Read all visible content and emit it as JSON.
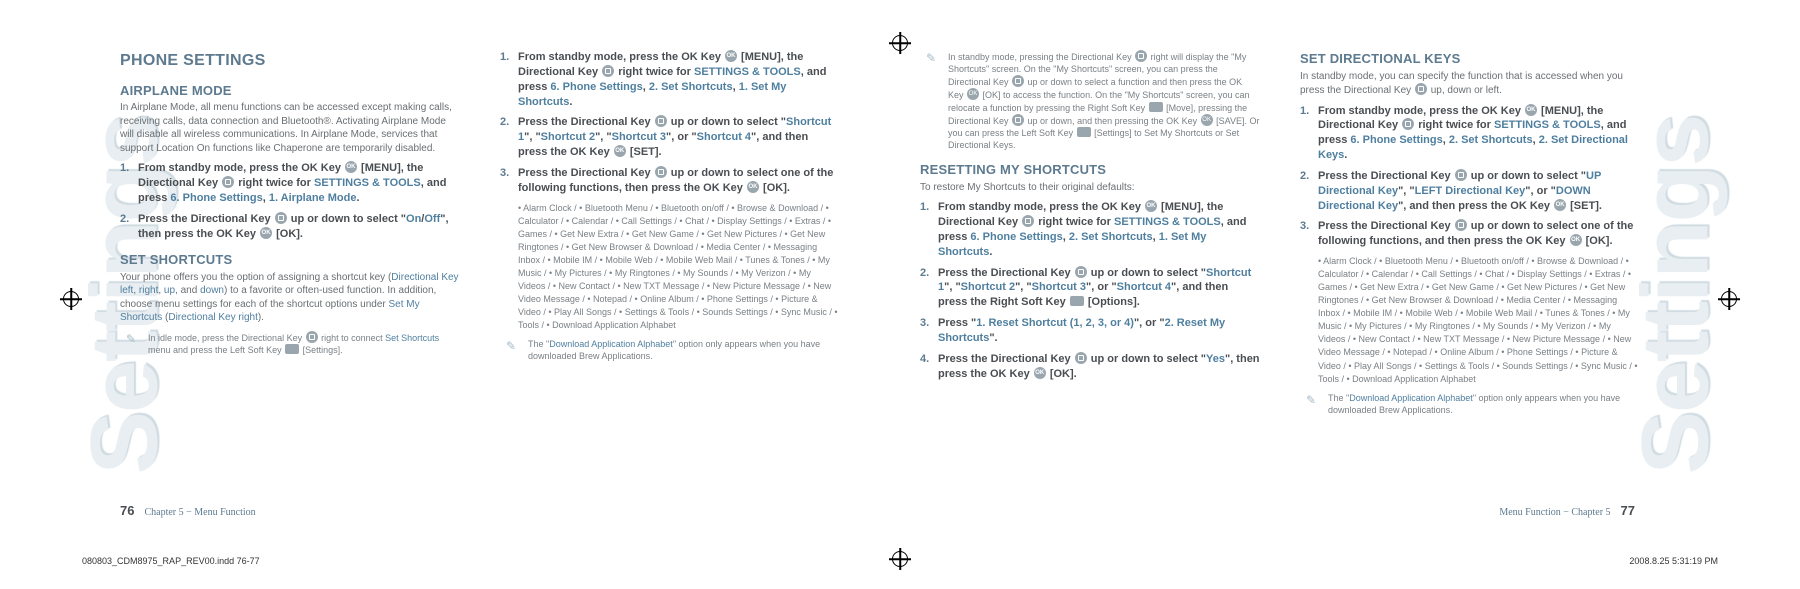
{
  "watermark": "Settings",
  "left": {
    "col1": {
      "h1": "PHONE SETTINGS",
      "airplane_h": "AIRPLANE MODE",
      "airplane_intro": "In Airplane Mode, all menu functions can be accessed except making calls, receiving calls, data connection and Bluetooth®. Activating Airplane Mode will disable all wireless communications. In Airplane Mode, services that support Location On functions like Chaperone are temporarily disabled.",
      "ap_s1a": "From standby mode, press the OK Key ",
      "ap_s1b": " [MENU], the Directional Key ",
      "ap_s1c": " right twice for ",
      "ap_s1d": "SETTINGS & TOOLS",
      "ap_s1e": ", and press ",
      "ap_s1f": "6. Phone Settings",
      "ap_s1g": ", ",
      "ap_s1h": "1. Airplane Mode",
      "ap_s1i": ".",
      "ap_s2a": "Press the Directional Key ",
      "ap_s2b": " up or down to select \"",
      "ap_s2c": "On",
      "ap_s2d": "/",
      "ap_s2e": "Off",
      "ap_s2f": "\", then press the OK Key ",
      "ap_s2g": " [OK].",
      "ss_h": "SET SHORTCUTS",
      "ss_intro_a": "Your phone offers you the option of assigning a shortcut key (",
      "ss_intro_b": "Directional Key left",
      "ss_intro_c": ", ",
      "ss_intro_d": "right",
      "ss_intro_e": ", ",
      "ss_intro_f": "up",
      "ss_intro_g": ", and ",
      "ss_intro_h": "down",
      "ss_intro_i": ") to a favorite or often-used function. In addition, choose menu settings for each of the shortcut options under ",
      "ss_intro_j": "Set My Shortcuts",
      "ss_intro_k": " (",
      "ss_intro_l": "Directional Key right",
      "ss_intro_m": ").",
      "ss_note_a": "In idle mode, press the Directional Key ",
      "ss_note_b": " right to connect ",
      "ss_note_c": "Set Shortcuts",
      "ss_note_d": " menu and press the Left Soft Key ",
      "ss_note_e": " [Settings]."
    },
    "col2": {
      "s1a": "From standby mode, press the OK Key ",
      "s1b": " [MENU], the Directional Key ",
      "s1c": " right twice for ",
      "s1d": "SETTINGS & TOOLS",
      "s1e": ", and press ",
      "s1f": "6. Phone Settings",
      "s1g": ", ",
      "s1h": "2. Set Shortcuts",
      "s1i": ", ",
      "s1j": "1. Set My Shortcuts",
      "s1k": ".",
      "s2a": "Press the Directional Key ",
      "s2b": " up or down to select \"",
      "s2c": "Shortcut 1",
      "s2d": "\", \"",
      "s2e": "Shortcut 2",
      "s2f": "\", \"",
      "s2g": "Shortcut 3",
      "s2h": "\", or \"",
      "s2i": "Shortcut 4",
      "s2j": "\", and then press the OK Key ",
      "s2k": " [SET].",
      "s3a": "Press the Directional Key ",
      "s3b": " up or down to select one of the following functions, then press the OK Key ",
      "s3c": " [OK].",
      "bullets": "•  Alarm Clock / •  Bluetooth Menu / •  Bluetooth on/off / •  Browse & Download / •  Calculator / •  Calendar / •  Call Settings / •  Chat / •  Display Settings / •  Extras / •  Games / •  Get New Extra / •  Get New Game / •  Get New Pictures / •  Get New Ringtones / •  Get New Browser & Download / •  Media Center / •  Messaging Inbox / •  Mobile IM / •  Mobile Web / •  Mobile Web Mail / •  Tunes & Tones / •  My Music / •  My Pictures / •  My Ringtones / •  My Sounds / •  My Verizon / •  My Videos / •  New Contact / •  New TXT Message / •  New Picture Message / •  New Video Message / •  Notepad / •  Online Album / •  Phone Settings / •  Picture & Video / •  Play All Songs / •  Settings & Tools / •  Sounds Settings / •  Sync Music / •  Tools / •  Download Application Alphabet",
      "note_a": "The \"",
      "note_b": "Download Application Alphabet",
      "note_c": "\" option only appears when you have downloaded Brew Applications."
    },
    "foot_num": "76",
    "foot_txt": "Chapter 5 − Menu Function"
  },
  "right": {
    "col1": {
      "topnote_a": "In standby mode, pressing the Directional Key ",
      "topnote_b": " right will display the \"My Shortcuts\" screen. On the \"My Shortcuts\" screen, you can press the Directional Key ",
      "topnote_c": " up or down to select a function and then press the OK Key ",
      "topnote_d": " [OK] to access the function. On the \"My Shortcuts\" screen, you can relocate a function by pressing the Right Soft Key ",
      "topnote_e": " [Move], pressing the Directional Key ",
      "topnote_f": " up or down, and then pressing the OK Key ",
      "topnote_g": " [SAVE]. Or you can press the Left Soft Key ",
      "topnote_h": " [Settings] to Set My Shortcuts or Set Directional Keys.",
      "rms_h": "RESETTING MY SHORTCUTS",
      "rms_intro": "To restore My Shortcuts to their original defaults:",
      "r1a": "From standby mode, press the OK Key ",
      "r1b": " [MENU], the Directional Key ",
      "r1c": " right twice for ",
      "r1d": "SETTINGS & TOOLS",
      "r1e": ", and press ",
      "r1f": "6. Phone Settings",
      "r1g": ", ",
      "r1h": "2. Set Shortcuts",
      "r1i": ", ",
      "r1j": "1. Set My Shortcuts",
      "r1k": ".",
      "r2a": "Press the Directional Key ",
      "r2b": " up or down to select \"",
      "r2c": "Shortcut 1",
      "r2d": "\", \"",
      "r2e": "Shortcut 2",
      "r2f": "\", \"",
      "r2g": "Shortcut 3",
      "r2h": "\", or \"",
      "r2i": "Shortcut 4",
      "r2j": "\", and then press the Right Soft Key ",
      "r2k": " [Options].",
      "r3a": "Press \"",
      "r3b": "1. Reset Shortcut (1, 2, 3, or 4)",
      "r3c": "\", or \"",
      "r3d": "2. Reset My Shortcuts",
      "r3e": "\".",
      "r4a": "Press the Directional Key ",
      "r4b": " up or down to select \"",
      "r4c": "Yes",
      "r4d": "\", then press the OK Key ",
      "r4e": " [OK]."
    },
    "col2": {
      "h": "SET DIRECTIONAL KEYS",
      "intro_a": "In standby mode, you can specify the function that is accessed when you press the Directional Key ",
      "intro_b": " up, down or left.",
      "d1a": "From standby mode, press the OK Key ",
      "d1b": " [MENU], the Directional Key ",
      "d1c": " right twice for ",
      "d1d": "SETTINGS & TOOLS",
      "d1e": ", and press ",
      "d1f": "6. Phone Settings",
      "d1g": ", ",
      "d1h": "2. Set Shortcuts",
      "d1i": ", ",
      "d1j": "2. Set Directional Keys",
      "d1k": ".",
      "d2a": "Press the Directional Key ",
      "d2b": " up or down to select \"",
      "d2c": "UP Directional Key",
      "d2d": "\", \"",
      "d2e": "LEFT Directional Key",
      "d2f": "\", or \"",
      "d2g": "DOWN Directional Key",
      "d2h": "\", and then press the OK Key ",
      "d2i": " [SET].",
      "d3a": "Press the Directional Key ",
      "d3b": " up or down to select one of the following functions, and then press the OK Key ",
      "d3c": " [OK].",
      "bullets": "•  Alarm Clock / •  Bluetooth Menu / •  Bluetooth on/off / •  Browse & Download / •  Calculator / •  Calendar / •  Call Settings / •  Chat / •  Display Settings / •  Extras / •  Games / •  Get New Extra / •  Get New Game / •  Get New Pictures / •  Get New Ringtones / •  Get New Browser & Download / •  Media Center / •  Messaging Inbox / •  Mobile IM / •  Mobile Web / •  Mobile Web Mail / •  Tunes & Tones / •  My Music / •  My Pictures / •  My Ringtones / •  My Sounds / •  My Verizon / •  My Videos / •  New Contact / •  New TXT Message / •  New Picture Message / •  New Video Message / •  Notepad / •  Online Album / •  Phone Settings / •  Picture & Video / •  Play All Songs / •  Settings & Tools / •  Sounds Settings / •  Sync Music / •  Tools / •  Download Application Alphabet",
      "note_a": "The \"",
      "note_b": "Download Application Alphabet",
      "note_c": "\" option only appears when you have downloaded Brew Applications."
    },
    "foot_txt": "Menu Function − Chapter 5",
    "foot_num": "77"
  },
  "file_left": "080803_CDM8975_RAP_REV00.indd   76-77",
  "file_right": "2008.8.25   5:31:19 PM"
}
